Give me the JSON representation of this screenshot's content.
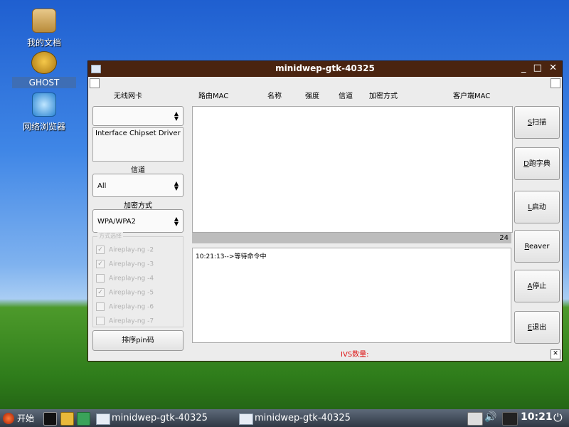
{
  "desktop": {
    "icons": [
      {
        "label": "我的文档"
      },
      {
        "label": "GHOST"
      },
      {
        "label": "网络浏览器"
      }
    ]
  },
  "window": {
    "title": "minidwep-gtk-40325",
    "controls": {
      "minimize": "_",
      "maximize": "□",
      "close": "✕"
    },
    "left": {
      "nic_label": "无线网卡",
      "nic_value": "",
      "drivers_text": "Interface Chipset Driver",
      "channel_label": "信道",
      "channel_value": "All",
      "encryption_label": "加密方式",
      "encryption_value": "WPA/WPA2",
      "options_title": "方式选择",
      "options": [
        {
          "label": "Aireplay-ng -2",
          "checked": true
        },
        {
          "label": "Aireplay-ng -3",
          "checked": true
        },
        {
          "label": "Aireplay-ng -4",
          "checked": false
        },
        {
          "label": "Aireplay-ng -5",
          "checked": true
        },
        {
          "label": "Aireplay-ng -6",
          "checked": false
        },
        {
          "label": "Aireplay-ng -7",
          "checked": false
        }
      ],
      "pin_button": "排序pin码"
    },
    "table": {
      "columns": [
        "路由MAC",
        "名称",
        "强度",
        "信道",
        "加密方式",
        "客户端MAC"
      ],
      "count": "24"
    },
    "log": {
      "lines": [
        "10:21:13-->等待命令中"
      ]
    },
    "ivs_label": "IVS数量:",
    "buttons": [
      {
        "key": "S",
        "text": "扫描"
      },
      {
        "key": "D",
        "text": "跑字典"
      },
      {
        "key": "L",
        "text": "启动"
      },
      {
        "key": "R",
        "text": "eaver"
      },
      {
        "key": "A",
        "text": "停止"
      },
      {
        "key": "E",
        "text": "退出"
      }
    ]
  },
  "taskbar": {
    "start_label": "开始",
    "tasks": [
      {
        "label": "minidwep-gtk-40325"
      },
      {
        "label": "minidwep-gtk-40325"
      }
    ],
    "clock": "10:21"
  }
}
